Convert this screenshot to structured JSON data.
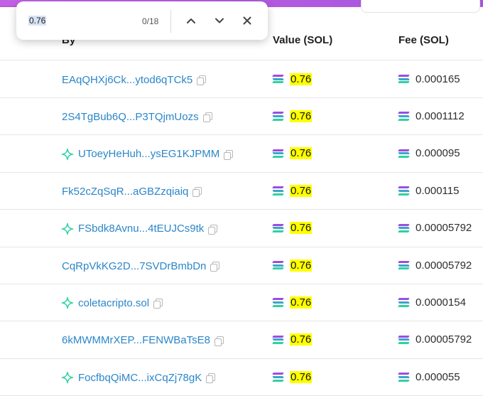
{
  "findbar": {
    "query": "0.76",
    "count": "0/18"
  },
  "table": {
    "headers": {
      "by": "By",
      "value": "Value (SOL)",
      "fee": "Fee (SOL)"
    },
    "rows": [
      {
        "by": "EAqQHXj6Ck...ytod6qTCk5",
        "value": "0.76",
        "fee": "0.000165",
        "tagged": false
      },
      {
        "by": "2S4TgBub6Q...P3TQjmUozs",
        "value": "0.76",
        "fee": "0.0001112",
        "tagged": false
      },
      {
        "by": "UToeyHeHuh...ysEG1KJPMM",
        "value": "0.76",
        "fee": "0.000095",
        "tagged": true
      },
      {
        "by": "Fk52cZqSqR...aGBZzqiaiq",
        "value": "0.76",
        "fee": "0.000115",
        "tagged": false
      },
      {
        "by": "FSbdk8Avnu...4tEUJCs9tk",
        "value": "0.76",
        "fee": "0.00005792",
        "tagged": true
      },
      {
        "by": "CqRpVkKG2D...7SVDrBmbDn",
        "value": "0.76",
        "fee": "0.00005792",
        "tagged": false
      },
      {
        "by": "coletacripto.sol",
        "value": "0.76",
        "fee": "0.0000154",
        "tagged": true
      },
      {
        "by": "6kMWMMrXEP...FENWBaTsE8",
        "value": "0.76",
        "fee": "0.00005792",
        "tagged": false
      },
      {
        "by": "FocfbqQiMC...ixCqZj78gK",
        "value": "0.76",
        "fee": "0.000055",
        "tagged": true
      }
    ]
  },
  "colors": {
    "accent_top": "#b45bd9",
    "link": "#2b86c9",
    "highlight": "#ffff00",
    "spark": "#2ed2a3"
  },
  "icons": [
    "sparkle-icon",
    "copy-icon",
    "solana-icon",
    "chevron-up-icon",
    "chevron-down-icon",
    "close-icon"
  ]
}
